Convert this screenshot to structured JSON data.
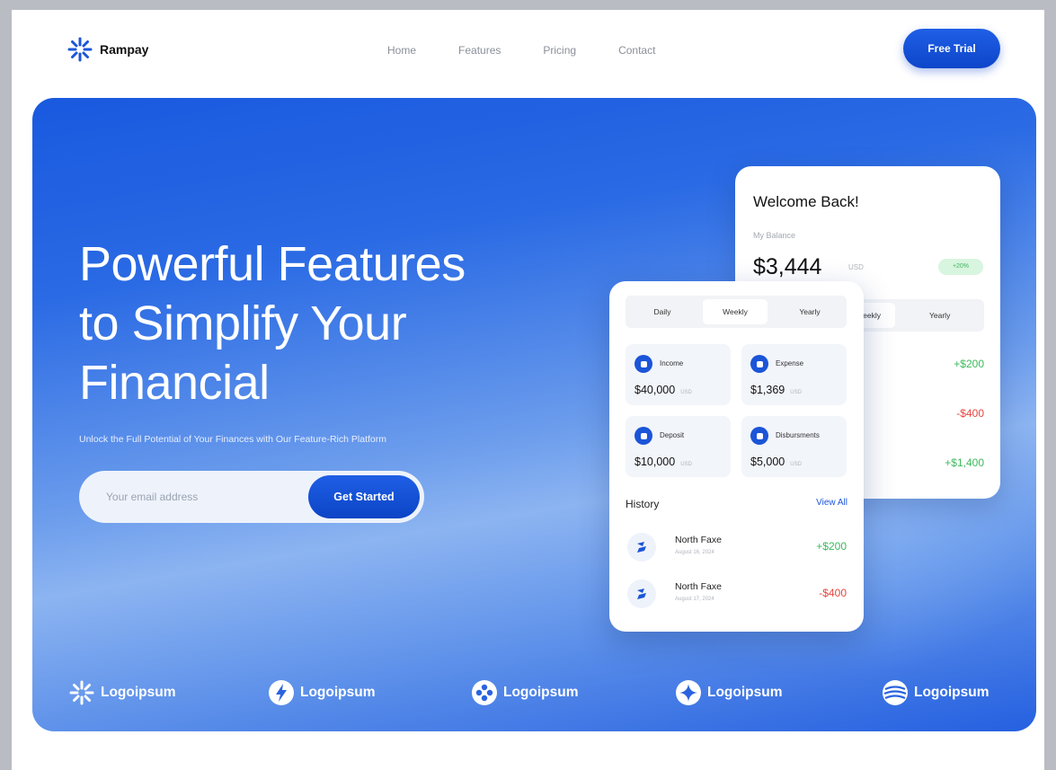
{
  "header": {
    "brand": "Rampay",
    "nav": [
      "Home",
      "Features",
      "Pricing",
      "Contact"
    ],
    "cta": "Free Trial"
  },
  "hero": {
    "headline_lines": [
      "Powerful Features",
      "to Simplify Your",
      "Financial"
    ],
    "subline": "Unlock the Full Potential of Your Finances with Our Feature-Rich Platform",
    "email_placeholder": "Your email address",
    "cta": "Get Started"
  },
  "back_card": {
    "welcome": "Welcome Back!",
    "balance_label": "My Balance",
    "balance": "$3,444",
    "balance_unit": "USD",
    "badge": "+20%",
    "tab_weekly_fragment": "eekly",
    "tab_yearly": "Yearly",
    "amounts": [
      "+$200",
      "-$400",
      "+$1,400"
    ]
  },
  "front_card": {
    "tabs": [
      "Daily",
      "Weekly",
      "Yearly"
    ],
    "stats": [
      {
        "label": "Income",
        "value": "$40,000",
        "unit": "USD"
      },
      {
        "label": "Expense",
        "value": "$1,369",
        "unit": "USD"
      },
      {
        "label": "Deposit",
        "value": "$10,000",
        "unit": "USD"
      },
      {
        "label": "Disbursments",
        "value": "$5,000",
        "unit": "USD"
      }
    ],
    "history_title": "History",
    "view_all": "View All",
    "history": [
      {
        "name": "North Faxe",
        "date": "August 16, 2024",
        "amount": "+$200"
      },
      {
        "name": "North Faxe",
        "date": "August 17, 2024",
        "amount": "-$400"
      }
    ]
  },
  "logos": [
    "Logoipsum",
    "Logoipsum",
    "Logoipsum",
    "Logoipsum",
    "Logoipsum"
  ],
  "colors": {
    "accent": "#1b55d8",
    "positive": "#3cba5c",
    "negative": "#e5463f"
  }
}
